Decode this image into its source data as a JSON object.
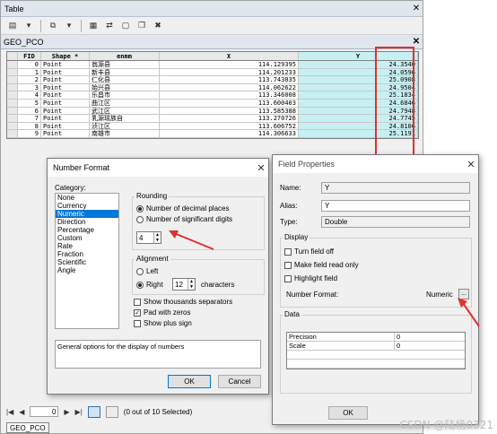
{
  "table_window": {
    "title": "Table",
    "layer_tab": "GEO_PCO",
    "columns": [
      "FID",
      "Shape *",
      "enmm",
      "X",
      "Y"
    ],
    "rows": [
      [
        "0",
        "Point",
        "翁源县",
        "114.129395",
        "24.3540"
      ],
      [
        "1",
        "Point",
        "新丰县",
        "114.201233",
        "24.0596"
      ],
      [
        "2",
        "Point",
        "仁化县",
        "113.743835",
        "25.0908"
      ],
      [
        "3",
        "Point",
        "始兴县",
        "114.062622",
        "24.9504"
      ],
      [
        "4",
        "Point",
        "乐昌市",
        "113.346008",
        "25.1834"
      ],
      [
        "5",
        "Point",
        "曲江区",
        "113.600403",
        "24.6846"
      ],
      [
        "6",
        "Point",
        "武江区",
        "113.585388",
        "24.7948"
      ],
      [
        "7",
        "Point",
        "乳源瑶族自",
        "113.270726",
        "24.7745"
      ],
      [
        "8",
        "Point",
        "浈江区",
        "113.606752",
        "24.8106"
      ],
      [
        "9",
        "Point",
        "南雄市",
        "114.306633",
        "25.1191"
      ]
    ],
    "record_value": "0",
    "status": "(0 out of 10 Selected)",
    "bottom_tab": "GEO_PCO"
  },
  "number_format": {
    "title": "Number Format",
    "category_label": "Category:",
    "categories": [
      "None",
      "Currency",
      "Numeric",
      "Direction",
      "Percentage",
      "Custom",
      "Rate",
      "Fraction",
      "Scientific",
      "Angle"
    ],
    "selected_category": "Numeric",
    "rounding_label": "Rounding",
    "opt_decimal": "Number of decimal places",
    "opt_significant": "Number of significant digits",
    "rounding_value": "4",
    "alignment_label": "Alignment",
    "opt_left": "Left",
    "opt_right": "Right",
    "characters_value": "12",
    "characters_label": "characters",
    "chk_thousands": "Show thousands separators",
    "chk_pad": "Pad with zeros",
    "chk_plus": "Show plus sign",
    "description": "General options for the display of numbers",
    "ok": "OK",
    "cancel": "Cancel"
  },
  "field_properties": {
    "title": "Field Properties",
    "name_label": "Name:",
    "name_value": "Y",
    "alias_label": "Alias:",
    "alias_value": "Y",
    "type_label": "Type:",
    "type_value": "Double",
    "display_label": "Display",
    "chk_turn_off": "Turn field off",
    "chk_read_only": "Make field read only",
    "chk_highlight": "Highlight field",
    "number_format_label": "Number Format:",
    "number_format_value": "Numeric",
    "ellipsis": "...",
    "data_label": "Data",
    "data_rows": [
      [
        "Precision",
        "0"
      ],
      [
        "Scale",
        "0"
      ]
    ],
    "ok": "OK"
  },
  "watermark": "CSDN @陆杨0321",
  "colors": {
    "highlight_column": "#c7f0f2",
    "annotation_red": "#e03030",
    "selection_blue": "#0078d7"
  }
}
